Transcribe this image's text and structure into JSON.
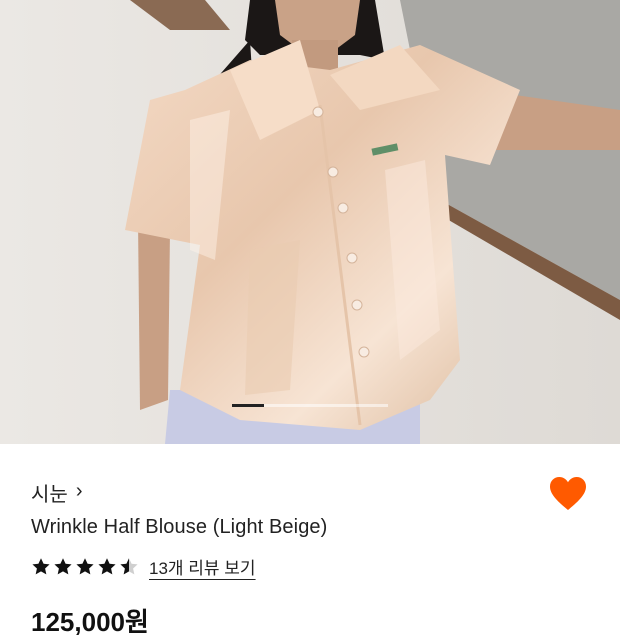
{
  "product": {
    "brand": "시눈",
    "brand_chevron": "›",
    "title": "Wrinkle Half Blouse (Light Beige)",
    "rating": 4.5,
    "rating_max": 5,
    "review_link": "13개 리뷰 보기",
    "price": "125,000원",
    "liked": true
  },
  "gallery": {
    "current_index": 1,
    "total_images": 5,
    "image_description": "product-photo"
  },
  "colors": {
    "heart": "#ff5a00",
    "star": "#111111",
    "text": "#222222"
  },
  "icons": {
    "like": "heart-icon",
    "star": "star-icon",
    "chevron": "chevron-right-icon"
  }
}
